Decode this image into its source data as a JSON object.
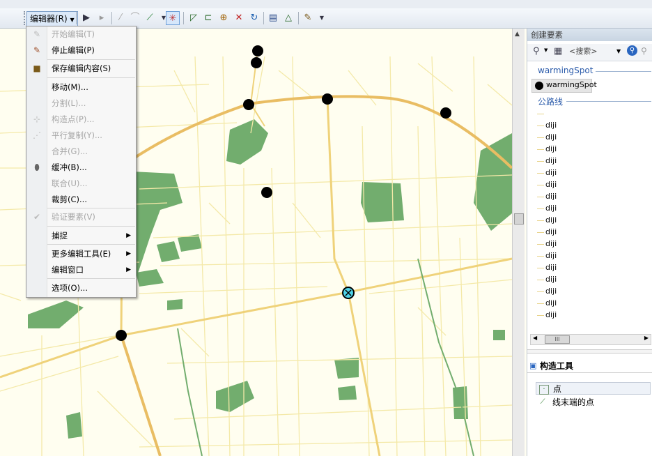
{
  "toolbar": {
    "editor_label": "编辑器(R)",
    "buttons": [
      "edit-tool-icon",
      "edit-annotation-icon",
      "straight-segment-icon",
      "end-point-arc-icon",
      "line-sketch-icon",
      "snap-target-icon",
      "reshape-feature-icon",
      "cut-polygon-icon",
      "split-tool-icon",
      "rotate-icon",
      "edit-vertices-icon",
      "attributes-icon",
      "sketch-properties-icon",
      "create-features-icon"
    ]
  },
  "menu": {
    "items": [
      {
        "label": "开始编辑(T)",
        "enabled": false,
        "icon": "start-edit-icon"
      },
      {
        "label": "停止编辑(P)",
        "enabled": true,
        "icon": "stop-edit-icon"
      },
      {
        "label": "保存编辑内容(S)",
        "enabled": true,
        "icon": "save-edits-icon"
      },
      {
        "label": "移动(M)...",
        "enabled": true,
        "icon": ""
      },
      {
        "label": "分割(L)...",
        "enabled": false,
        "icon": ""
      },
      {
        "label": "构造点(P)...",
        "enabled": false,
        "icon": "construct-points-icon"
      },
      {
        "label": "平行复制(Y)...",
        "enabled": false,
        "icon": "copy-parallel-icon"
      },
      {
        "label": "合并(G)...",
        "enabled": false,
        "icon": ""
      },
      {
        "label": "缓冲(B)...",
        "enabled": true,
        "icon": "buffer-icon"
      },
      {
        "label": "联合(U)...",
        "enabled": false,
        "icon": ""
      },
      {
        "label": "裁剪(C)...",
        "enabled": true,
        "icon": ""
      },
      {
        "label": "验证要素(V)",
        "enabled": false,
        "icon": "validate-features-icon"
      },
      {
        "label": "捕捉",
        "enabled": true,
        "icon": "",
        "submenu": true
      },
      {
        "label": "更多编辑工具(E)",
        "enabled": true,
        "icon": "",
        "submenu": true
      },
      {
        "label": "编辑窗口",
        "enabled": true,
        "icon": "",
        "submenu": true
      },
      {
        "label": "选项(O)...",
        "enabled": true,
        "icon": ""
      }
    ]
  },
  "panel": {
    "title": "创建要素",
    "search_placeholder": "<搜索>",
    "group1": "warmingSpot",
    "template1": "warmingSpot",
    "group2": "公路线",
    "road_items": [
      "",
      "diji",
      "diji",
      "diji",
      "diji",
      "diji",
      "diji",
      "diji",
      "diji",
      "diji",
      "diji",
      "diji",
      "diji",
      "diji",
      "diji",
      "diji",
      "diji",
      "diji"
    ],
    "construct_title": "构造工具",
    "construct_items": [
      "点",
      "线末端的点"
    ]
  },
  "colors": {
    "map_bg": "#fffef0",
    "minor_road": "#f4e9a8",
    "major_road": "#e9bd63",
    "green": "#72ad6e",
    "point": "#000000",
    "selected_point": "#4fd3e8"
  }
}
